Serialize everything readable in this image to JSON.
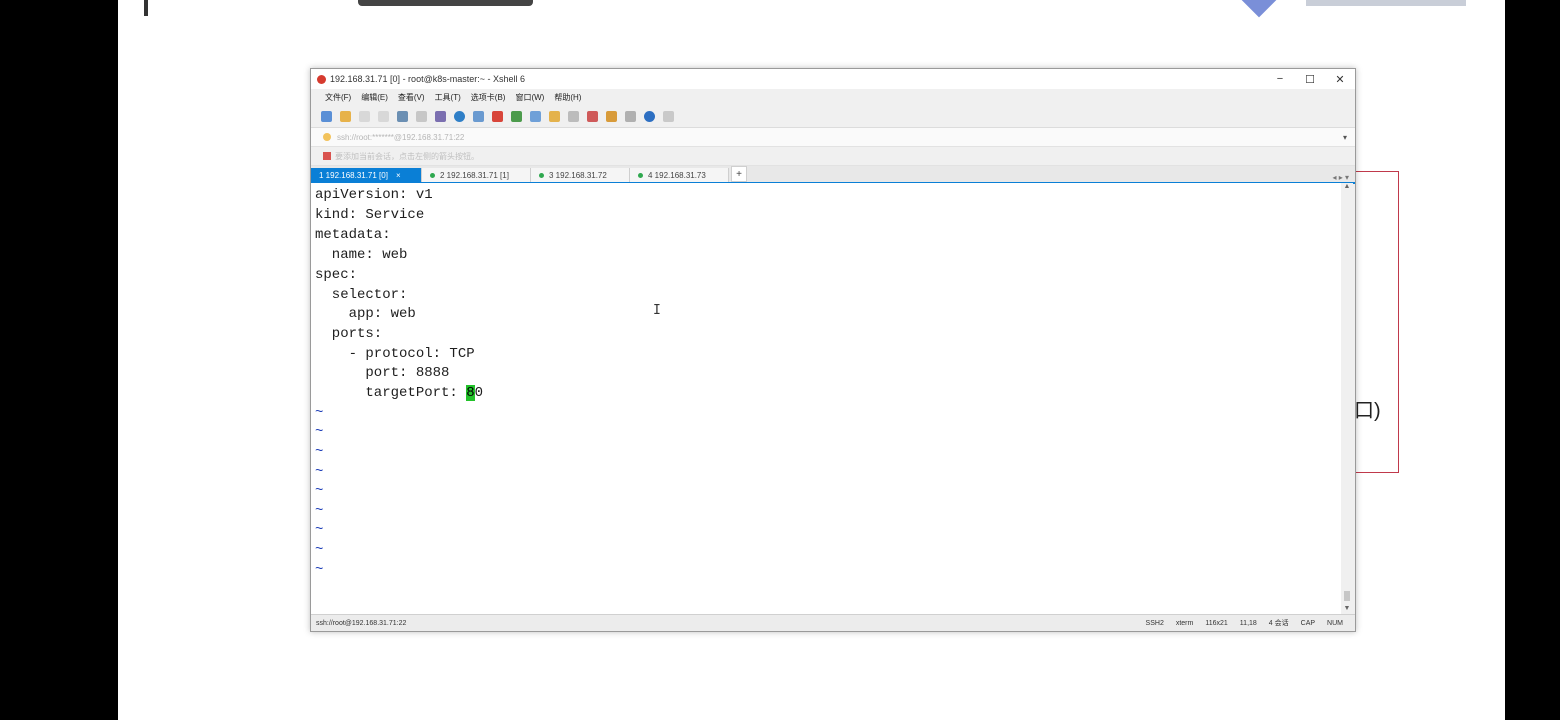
{
  "window": {
    "title": "192.168.31.71 [0] - root@k8s-master:~ - Xshell 6",
    "minimize": "−",
    "maximize": "☐",
    "close": "✕"
  },
  "menu": [
    "文件(F)",
    "编辑(E)",
    "查看(V)",
    "工具(T)",
    "选项卡(B)",
    "窗口(W)",
    "帮助(H)"
  ],
  "address_bar": {
    "text": "ssh://root:*******@192.168.31.71:22",
    "dropdown": "▾"
  },
  "session_bar": {
    "text": "要添加当前会话，点击左侧的箭头按钮。"
  },
  "tabs": [
    {
      "label": "1 192.168.31.71 [0]",
      "close": "×"
    },
    {
      "label": "2 192.168.31.71 [1]"
    },
    {
      "label": "3 192.168.31.72"
    },
    {
      "label": "4 192.168.31.73"
    }
  ],
  "tab_add": "+",
  "tabs_right": "◂ ▸ ▾",
  "terminal": {
    "lines": [
      "apiVersion: v1",
      "kind: Service",
      "metadata:",
      "  name: web",
      "spec:",
      "  selector:",
      "    app: web",
      "  ports:",
      "    - protocol: TCP",
      "      port: 8888",
      "      targetPort: "
    ],
    "cursor_text": "8",
    "cursor_rest": "0",
    "tilde": "~",
    "ibeam": "I"
  },
  "status": {
    "left": "ssh://root@192.168.31.71:22",
    "protocol": "SSH2",
    "term": "xterm",
    "size": "116x21",
    "position": "11,18",
    "sessions": "4 会话",
    "caps": "CAP",
    "num": "NUM"
  },
  "slide": {
    "fragment": "口)"
  },
  "colors": {
    "tab_active": "#0a7fd6",
    "cursor": "#22c22a",
    "tilde": "#1f3fb8",
    "slide_box": "#c0394b"
  }
}
